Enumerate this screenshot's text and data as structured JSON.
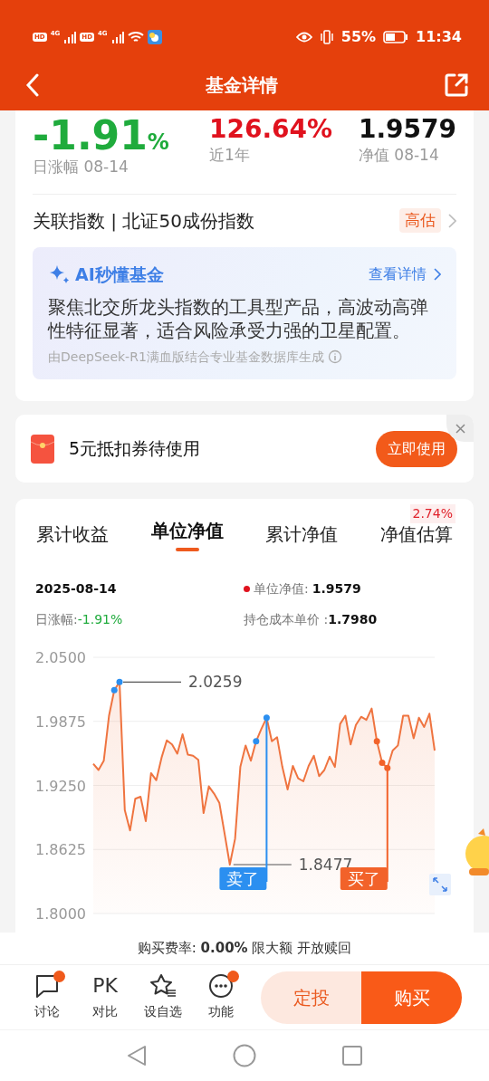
{
  "status_bar": {
    "networks": [
      {
        "hd": "HD",
        "net": "4G"
      },
      {
        "hd": "HD",
        "net": "4G"
      }
    ],
    "battery_text": "55%",
    "time": "11:34"
  },
  "header": {
    "title": "基金详情"
  },
  "stats": [
    {
      "value": "-1.91",
      "unit": "%",
      "label": "日涨幅 08-14",
      "kind": "down"
    },
    {
      "value": "126.64%",
      "label": "近1年",
      "kind": "up"
    },
    {
      "value": "1.9579",
      "label": "净值 08-14",
      "kind": "flat"
    }
  ],
  "index_row": {
    "text": "关联指数 | 北证50成份指数",
    "badge": "高估"
  },
  "ai_box": {
    "title": "AI秒懂基金",
    "link": "查看详情",
    "summary": "聚焦北交所龙头指数的工具型产品，高波动高弹性特征显著，适合风险承受力强的卫星配置。",
    "source": "由DeepSeek-R1满血版结合专业基金数据库生成"
  },
  "coupon": {
    "text": "5元抵扣券待使用",
    "button": "立即使用"
  },
  "chart_tabs": [
    {
      "label": "累计收益",
      "selected": false
    },
    {
      "label": "单位净值",
      "selected": true
    },
    {
      "label": "累计净值",
      "selected": false
    },
    {
      "label": "净值估算",
      "selected": false,
      "badge": "2.74%"
    }
  ],
  "tooltip": {
    "date": "2025-08-14",
    "nav_label": "单位净值:",
    "nav_value": "1.9579",
    "change_label": "日涨幅:",
    "change_value": "-1.91%",
    "cost_label": "持仓成本单价 :",
    "cost_value": "1.7980"
  },
  "chart_data": {
    "type": "area",
    "grid": true,
    "ylim": [
      1.8,
      2.05
    ],
    "yticks": [
      {
        "value": 2.05,
        "label": "2.0500"
      },
      {
        "value": 1.9875,
        "label": "1.9875"
      },
      {
        "value": 1.925,
        "label": "1.9250"
      },
      {
        "value": 1.8625,
        "label": "1.8625"
      },
      {
        "value": 1.8,
        "label": "1.8000"
      }
    ],
    "series": [
      {
        "color": "#ef7440",
        "values": [
          1.946,
          1.94,
          1.949,
          1.993,
          2.018,
          2.0259,
          1.901,
          1.881,
          1.912,
          1.914,
          1.89,
          1.937,
          1.93,
          1.952,
          1.969,
          1.965,
          1.956,
          1.975,
          1.955,
          1.954,
          1.95,
          1.898,
          1.924,
          1.917,
          1.908,
          1.878,
          1.8477,
          1.873,
          1.943,
          1.964,
          1.949,
          1.968,
          1.98,
          1.991,
          1.968,
          1.972,
          1.943,
          1.921,
          1.944,
          1.932,
          1.929,
          1.944,
          1.954,
          1.934,
          1.94,
          1.953,
          1.943,
          1.985,
          1.993,
          1.965,
          1.984,
          1.992,
          1.989,
          2.0,
          1.968,
          1.947,
          1.942,
          1.959,
          1.964,
          1.993,
          1.993,
          1.971,
          1.991,
          1.982,
          1.995,
          1.959
        ]
      }
    ],
    "annotations": [
      "2.0259",
      "1.8477"
    ]
  },
  "trade_marks": [
    {
      "kind": "sell",
      "text": "卖了",
      "color": "#2b8ff0"
    },
    {
      "kind": "buy",
      "text": "买了",
      "color": "#f2622a"
    }
  ],
  "fee_line": "购买费率: **0.00%** 限大额 开放赎回",
  "actions": [
    {
      "kind": "chat",
      "label": "讨论",
      "dot": true
    },
    {
      "kind": "pk",
      "glyph": "PK",
      "label": "对比",
      "dot": false
    },
    {
      "kind": "star",
      "label": "设自选",
      "dot": false
    },
    {
      "kind": "more",
      "label": "功能",
      "dot": true
    }
  ],
  "buttons": [
    {
      "kind": "secondary",
      "label": "定投"
    },
    {
      "kind": "primary",
      "label": "购买"
    }
  ]
}
